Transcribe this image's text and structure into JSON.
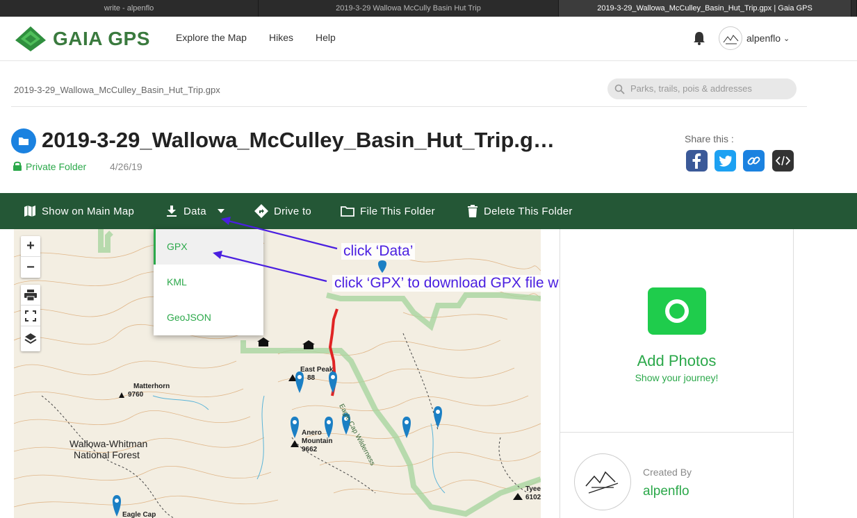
{
  "browser_tabs": [
    {
      "title": "write - alpenflo"
    },
    {
      "title": "2019-3-29 Wallowa McCully Basin Hut Trip"
    },
    {
      "title": "2019-3-29_Wallowa_McCulley_Basin_Hut_Trip.gpx | Gaia GPS"
    }
  ],
  "header": {
    "logo_text": "GAIA GPS",
    "nav": [
      "Explore the Map",
      "Hikes",
      "Help"
    ],
    "username": "alpenflo"
  },
  "breadcrumb": "2019-3-29_Wallowa_McCulley_Basin_Hut_Trip.gpx",
  "search": {
    "placeholder": "Parks, trails, pois & addresses"
  },
  "folder": {
    "title": "2019-3-29_Wallowa_McCulley_Basin_Hut_Trip.gpx",
    "privacy": "Private Folder",
    "date": "4/26/19"
  },
  "share": {
    "label": "Share this :",
    "buttons": [
      "facebook",
      "twitter",
      "link",
      "embed"
    ]
  },
  "actions": {
    "show_on_map": "Show on Main Map",
    "data": "Data",
    "drive_to": "Drive to",
    "file_folder": "File This Folder",
    "delete_folder": "Delete This Folder"
  },
  "data_menu": [
    "GPX",
    "KML",
    "GeoJSON"
  ],
  "annotations": {
    "a1": "click ‘Data’",
    "a2": "click ‘GPX’ to download GPX file with waypoints"
  },
  "map_labels": {
    "matterhorn": "Matterhorn",
    "matterhorn_elev": "9760",
    "forest_1": "Wallowa-Whitman",
    "forest_2": "National Forest",
    "east_peak": "East Peak",
    "east_peak_elev": "88",
    "aneroid": "Anero",
    "aneroid_2": "Mountain",
    "aneroid_elev": "9662",
    "wilderness": "Eagle Cap Wilderness",
    "eagle_cap": "Eagle Cap",
    "tyee": "Tyee",
    "tyee_elev": "6102"
  },
  "panel": {
    "add_photos": "Add Photos",
    "show_journey": "Show your journey!",
    "created_by": "Created By",
    "creator": "alpenflo"
  },
  "colors": {
    "brand_green": "#245736",
    "link_green": "#2ba84a",
    "annotation": "#4a1fe0",
    "folder_blue": "#1b82e0"
  }
}
